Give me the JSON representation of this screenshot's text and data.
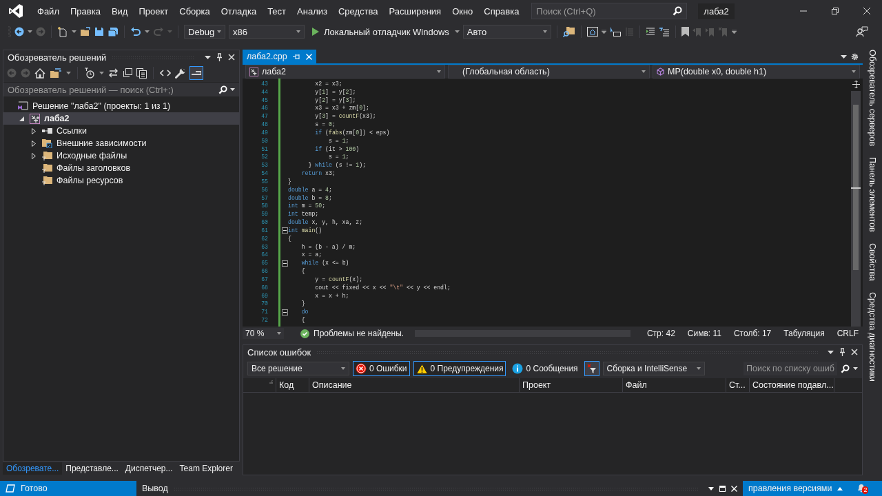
{
  "window": {
    "title": "лаба2"
  },
  "menu": [
    "Файл",
    "Правка",
    "Вид",
    "Проект",
    "Сборка",
    "Отладка",
    "Тест",
    "Анализ",
    "Средства",
    "Расширения",
    "Окно",
    "Справка"
  ],
  "search": {
    "placeholder": "Поиск (Ctrl+Q)"
  },
  "toolbar": {
    "configuration": "Debug",
    "platform": "x86",
    "debugger": "Локальный отладчик Windows",
    "mode": "Авто"
  },
  "solution_explorer": {
    "title": "Обозреватель решений",
    "search_placeholder": "Обозреватель решений — поиск (Ctrl+;)",
    "tree": [
      {
        "label": "Решение \"лаба2\" (проекты: 1 из 1)",
        "kind": "solution",
        "selected": false,
        "children": [
          {
            "label": "лаба2",
            "kind": "project",
            "selected": true,
            "expanded": true,
            "children": [
              {
                "label": "Ссылки",
                "kind": "references",
                "selected": false,
                "expanded": false
              },
              {
                "label": "Внешние зависимости",
                "kind": "external",
                "selected": false,
                "expanded": false
              },
              {
                "label": "Исходные файлы",
                "kind": "filter",
                "selected": false,
                "expanded": false
              },
              {
                "label": "Файлы заголовков",
                "kind": "filter",
                "selected": false
              },
              {
                "label": "Файлы ресурсов",
                "kind": "filter",
                "selected": false
              }
            ]
          }
        ]
      }
    ]
  },
  "bottom_tabs": [
    {
      "label": "Обозревате...",
      "selected": true
    },
    {
      "label": "Представле...",
      "selected": false
    },
    {
      "label": "Диспетчер...",
      "selected": false
    },
    {
      "label": "Team Explorer",
      "selected": false
    }
  ],
  "editor": {
    "tabs": [
      {
        "label": "лаба2.cpp",
        "selected": true
      }
    ],
    "nav": {
      "project": "лаба2",
      "scope": "(Глобальная область)",
      "member": "MP(double x0, double h1)"
    },
    "lines": [
      {
        "n": "43",
        "fold": false,
        "t": [
          {
            "kind": "plain",
            "text": "        x2 = x3;"
          }
        ]
      },
      {
        "n": "44",
        "fold": false,
        "t": [
          {
            "kind": "plain",
            "text": "        y["
          },
          {
            "kind": "num",
            "text": "1"
          },
          {
            "kind": "plain",
            "text": "] = y["
          },
          {
            "kind": "num",
            "text": "2"
          },
          {
            "kind": "plain",
            "text": "];"
          }
        ]
      },
      {
        "n": "45",
        "fold": false,
        "t": [
          {
            "kind": "plain",
            "text": "        y["
          },
          {
            "kind": "num",
            "text": "2"
          },
          {
            "kind": "plain",
            "text": "] = y["
          },
          {
            "kind": "num",
            "text": "3"
          },
          {
            "kind": "plain",
            "text": "];"
          }
        ]
      },
      {
        "n": "46",
        "fold": false,
        "t": [
          {
            "kind": "plain",
            "text": "        x3 = x3 + zm["
          },
          {
            "kind": "num",
            "text": "0"
          },
          {
            "kind": "plain",
            "text": "];"
          }
        ]
      },
      {
        "n": "47",
        "fold": false,
        "t": [
          {
            "kind": "plain",
            "text": "        y["
          },
          {
            "kind": "num",
            "text": "3"
          },
          {
            "kind": "plain",
            "text": "] = "
          },
          {
            "kind": "fn",
            "text": "countF"
          },
          {
            "kind": "plain",
            "text": "(x3);"
          }
        ]
      },
      {
        "n": "48",
        "fold": false,
        "t": [
          {
            "kind": "plain",
            "text": "        s = "
          },
          {
            "kind": "num",
            "text": "0"
          },
          {
            "kind": "plain",
            "text": ";"
          }
        ]
      },
      {
        "n": "49",
        "fold": false,
        "t": [
          {
            "kind": "kw",
            "text": "        if"
          },
          {
            "kind": "plain",
            "text": " ("
          },
          {
            "kind": "fn",
            "text": "fabs"
          },
          {
            "kind": "plain",
            "text": "(zm["
          },
          {
            "kind": "num",
            "text": "0"
          },
          {
            "kind": "plain",
            "text": "]) < eps)"
          }
        ]
      },
      {
        "n": "50",
        "fold": false,
        "t": [
          {
            "kind": "plain",
            "text": "            s = "
          },
          {
            "kind": "num",
            "text": "1"
          },
          {
            "kind": "plain",
            "text": ";"
          }
        ]
      },
      {
        "n": "51",
        "fold": false,
        "t": [
          {
            "kind": "kw",
            "text": "        if"
          },
          {
            "kind": "plain",
            "text": " (it > "
          },
          {
            "kind": "num",
            "text": "100"
          },
          {
            "kind": "plain",
            "text": ")"
          }
        ]
      },
      {
        "n": "52",
        "fold": false,
        "t": [
          {
            "kind": "plain",
            "text": "            s = "
          },
          {
            "kind": "num",
            "text": "1"
          },
          {
            "kind": "plain",
            "text": ";"
          }
        ]
      },
      {
        "n": "53",
        "fold": false,
        "t": [
          {
            "kind": "plain",
            "text": "      } "
          },
          {
            "kind": "kw",
            "text": "while"
          },
          {
            "kind": "plain",
            "text": " (s != "
          },
          {
            "kind": "num",
            "text": "1"
          },
          {
            "kind": "plain",
            "text": ");"
          }
        ]
      },
      {
        "n": "54",
        "fold": false,
        "t": [
          {
            "kind": "kw",
            "text": "    return"
          },
          {
            "kind": "plain",
            "text": " x3;"
          }
        ]
      },
      {
        "n": "55",
        "fold": false,
        "t": [
          {
            "kind": "plain",
            "text": "}"
          }
        ]
      },
      {
        "n": "56",
        "fold": false,
        "t": [
          {
            "kind": "kw",
            "text": "double"
          },
          {
            "kind": "plain",
            "text": " a = "
          },
          {
            "kind": "num",
            "text": "4"
          },
          {
            "kind": "plain",
            "text": ";"
          }
        ]
      },
      {
        "n": "57",
        "fold": false,
        "t": [
          {
            "kind": "kw",
            "text": "double"
          },
          {
            "kind": "plain",
            "text": " b = "
          },
          {
            "kind": "num",
            "text": "8"
          },
          {
            "kind": "plain",
            "text": ";"
          }
        ]
      },
      {
        "n": "58",
        "fold": false,
        "t": [
          {
            "kind": "kw",
            "text": "int"
          },
          {
            "kind": "plain",
            "text": " m = "
          },
          {
            "kind": "num",
            "text": "50"
          },
          {
            "kind": "plain",
            "text": ";"
          }
        ]
      },
      {
        "n": "59",
        "fold": false,
        "t": [
          {
            "kind": "kw",
            "text": "int"
          },
          {
            "kind": "plain",
            "text": " temp;"
          }
        ]
      },
      {
        "n": "60",
        "fold": false,
        "t": [
          {
            "kind": "kw",
            "text": "double"
          },
          {
            "kind": "plain",
            "text": " x, y, h, xa, z;"
          }
        ]
      },
      {
        "n": "61",
        "fold": true,
        "t": [
          {
            "kind": "kw",
            "text": "int"
          },
          {
            "kind": "fn",
            "text": " main"
          },
          {
            "kind": "plain",
            "text": "()"
          }
        ]
      },
      {
        "n": "62",
        "fold": false,
        "t": [
          {
            "kind": "plain",
            "text": "{"
          }
        ]
      },
      {
        "n": "63",
        "fold": false,
        "t": [
          {
            "kind": "plain",
            "text": "    h = (b - a) / m;"
          }
        ]
      },
      {
        "n": "64",
        "fold": false,
        "t": [
          {
            "kind": "plain",
            "text": "    x = a;"
          }
        ]
      },
      {
        "n": "65",
        "fold": true,
        "t": [
          {
            "kind": "kw",
            "text": "    while"
          },
          {
            "kind": "plain",
            "text": " (x <= b)"
          }
        ]
      },
      {
        "n": "66",
        "fold": false,
        "t": [
          {
            "kind": "plain",
            "text": "    {"
          }
        ]
      },
      {
        "n": "67",
        "fold": false,
        "t": [
          {
            "kind": "plain",
            "text": "        y = "
          },
          {
            "kind": "fn",
            "text": "countF"
          },
          {
            "kind": "plain",
            "text": "(x);"
          }
        ]
      },
      {
        "n": "68",
        "fold": false,
        "t": [
          {
            "kind": "plain",
            "text": "        cout << fixed << x << "
          },
          {
            "kind": "str",
            "text": "\"\\t\""
          },
          {
            "kind": "plain",
            "text": " << y << endl;"
          }
        ]
      },
      {
        "n": "69",
        "fold": false,
        "t": [
          {
            "kind": "plain",
            "text": "        x = x + h;"
          }
        ]
      },
      {
        "n": "70",
        "fold": false,
        "t": [
          {
            "kind": "plain",
            "text": "    }"
          }
        ]
      },
      {
        "n": "71",
        "fold": true,
        "t": [
          {
            "kind": "kw",
            "text": "    do"
          }
        ]
      },
      {
        "n": "72",
        "fold": false,
        "t": [
          {
            "kind": "plain",
            "text": "    {"
          }
        ]
      }
    ],
    "zoom": "70 %",
    "health": "Проблемы не найдены.",
    "position": [
      "Стр: 42",
      "Симв: 11",
      "Столб: 17",
      "Табуляция",
      "CRLF"
    ]
  },
  "error_list": {
    "title": "Список ошибок",
    "scope": "Все решение",
    "filters": [
      {
        "kind": "error",
        "label": "0 Ошибки",
        "on": true
      },
      {
        "kind": "warning",
        "label": "0 Предупреждения",
        "on": true
      },
      {
        "kind": "info",
        "label": "0 Сообщения",
        "on": false
      }
    ],
    "build_filter": "Сборка и IntelliSense",
    "search_placeholder": "Поиск по списку ошиб",
    "columns": [
      "Код",
      "Описание",
      "Проект",
      "Файл",
      "Ст...",
      "Состояние подавл..."
    ]
  },
  "side_tabs": [
    "Обозреватель серверов",
    "Панель элементов",
    "Свойства",
    "Средства диагностики"
  ],
  "status_bar": {
    "status": "Готово",
    "output_tab": "Вывод",
    "source_control": "правления версиями",
    "notifications": "2"
  }
}
